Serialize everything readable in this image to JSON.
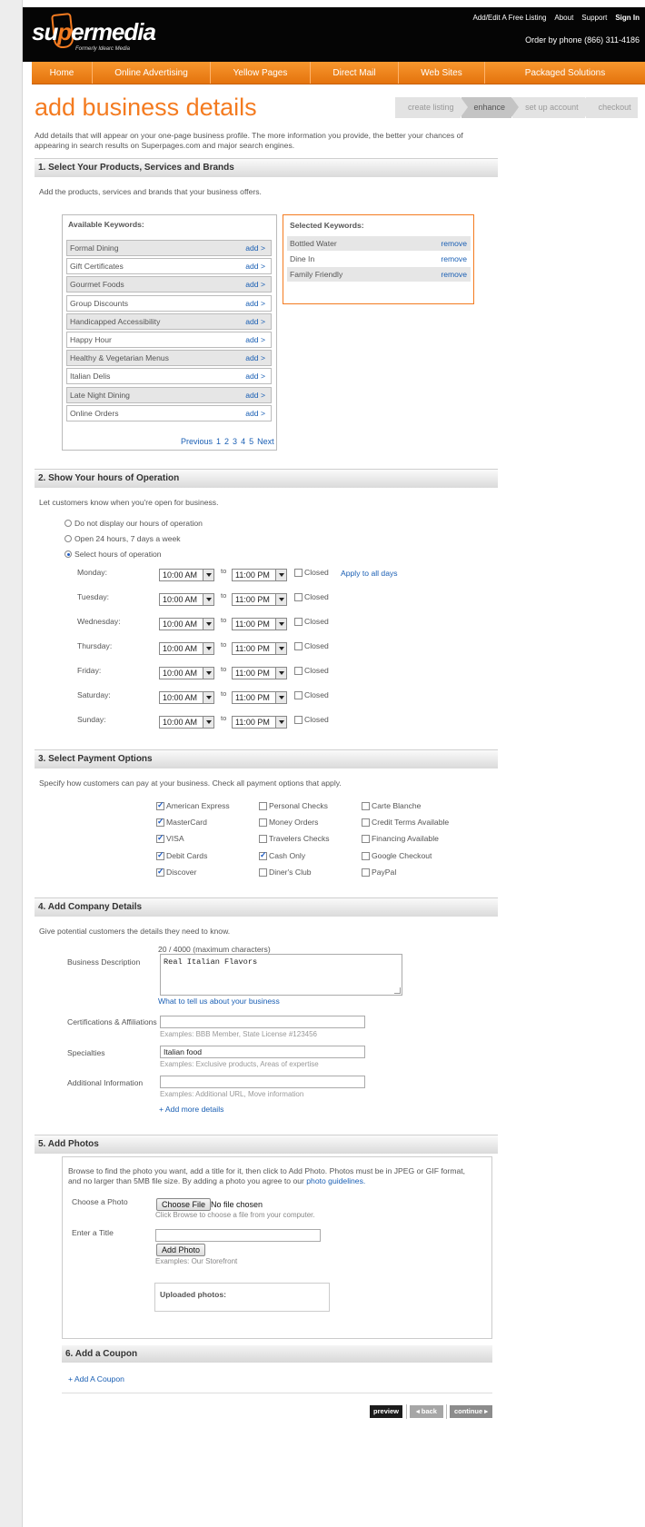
{
  "header": {
    "logo": {
      "brand": "supermedia",
      "subtitle": "Formerly Idearc Media"
    },
    "top_links": [
      "Add/Edit A Free Listing",
      "About",
      "Support",
      "Sign In"
    ],
    "phone": "Order by phone (866) 311-4186"
  },
  "nav": [
    "Home",
    "Online Advertising",
    "Yellow Pages",
    "Direct Mail",
    "Web Sites",
    "Packaged Solutions"
  ],
  "page_title": "add business details",
  "steps": [
    "create listing",
    "enhance",
    "set up account",
    "checkout"
  ],
  "active_step": "enhance",
  "intro": "Add details that will appear on your one-page business profile. The more information you provide, the better your chances of appearing in search results on Superpages.com and major search engines.",
  "section1": {
    "heading": "1. Select Your Products, Services and Brands",
    "desc": "Add the products, services and brands that your business offers.",
    "available_title": "Available Keywords:",
    "available": [
      "Formal Dining",
      "Gift Certificates",
      "Gourmet Foods",
      "Group Discounts",
      "Handicapped Accessibility",
      "Happy Hour",
      "Healthy & Vegetarian Menus",
      "Italian Delis",
      "Late Night Dining",
      "Online Orders"
    ],
    "add_label": "add >",
    "selected_title": "Selected Keywords:",
    "selected": [
      "Bottled Water",
      "Dine In",
      "Family Friendly"
    ],
    "remove_label": "remove",
    "pager": [
      "Previous",
      "1",
      "2",
      "3",
      "4",
      "5",
      "Next"
    ]
  },
  "section2": {
    "heading": "2. Show Your hours of Operation",
    "desc": "Let customers know when you're open for business.",
    "options": [
      "Do not display our hours of operation",
      "Open 24 hours, 7 days a week",
      "Select hours of operation"
    ],
    "selected_option": 2,
    "to_label": "to",
    "closed_label": "Closed",
    "apply_all": "Apply to all days",
    "days": [
      {
        "day": "Monday:",
        "open": "10:00 AM",
        "close": "11:00 PM"
      },
      {
        "day": "Tuesday:",
        "open": "10:00 AM",
        "close": "11:00 PM"
      },
      {
        "day": "Wednesday:",
        "open": "10:00 AM",
        "close": "11:00 PM"
      },
      {
        "day": "Thursday:",
        "open": "10:00 AM",
        "close": "11:00 PM"
      },
      {
        "day": "Friday:",
        "open": "10:00 AM",
        "close": "11:00 PM"
      },
      {
        "day": "Saturday:",
        "open": "10:00 AM",
        "close": "11:00 PM"
      },
      {
        "day": "Sunday:",
        "open": "10:00 AM",
        "close": "11:00 PM"
      }
    ]
  },
  "section3": {
    "heading": "3. Select Payment Options",
    "desc": "Specify how customers can pay at your business. Check all payment options that apply.",
    "options": [
      {
        "label": "American Express",
        "checked": true
      },
      {
        "label": "MasterCard",
        "checked": true
      },
      {
        "label": "VISA",
        "checked": true
      },
      {
        "label": "Debit Cards",
        "checked": true
      },
      {
        "label": "Discover",
        "checked": true
      },
      {
        "label": "Personal Checks",
        "checked": false
      },
      {
        "label": "Money Orders",
        "checked": false
      },
      {
        "label": "Travelers Checks",
        "checked": false
      },
      {
        "label": "Cash Only",
        "checked": true
      },
      {
        "label": "Diner's Club",
        "checked": false
      },
      {
        "label": "Carte Blanche",
        "checked": false
      },
      {
        "label": "Credit Terms Available",
        "checked": false
      },
      {
        "label": "Financing Available",
        "checked": false
      },
      {
        "label": "Google Checkout",
        "checked": false
      },
      {
        "label": "PayPal",
        "checked": false
      }
    ]
  },
  "section4": {
    "heading": "4. Add Company Details",
    "desc": "Give potential customers the details they need to know.",
    "char_count": "20 / 4000 (maximum characters)",
    "desc_label": "Business Description",
    "desc_value": "Real Italian Flavors",
    "desc_help": "What to tell us about your business",
    "cert_label": "Certifications & Affiliations",
    "cert_value": "",
    "cert_hint": "Examples: BBB Member, State License #123456",
    "spec_label": "Specialties",
    "spec_value": "Italian food",
    "spec_hint": "Examples: Exclusive products, Areas of expertise",
    "addl_label": "Additional Information",
    "addl_value": "",
    "addl_hint": "Examples: Additional URL, Move information",
    "add_more": "+ Add more details"
  },
  "section5": {
    "heading": "5. Add Photos",
    "desc_pre": "Browse to find the photo you want, add a title for it, then click to Add Photo. Photos must be in JPEG or GIF format, and no larger than 5MB file size. By adding a photo you agree to our",
    "desc_link": "photo guidelines.",
    "choose_label": "Choose a Photo",
    "choose_btn": "Choose File",
    "no_file": "No file chosen",
    "choose_hint": "Click Browse to choose a file from your computer.",
    "title_label": "Enter a Title",
    "title_value": "",
    "add_btn": "Add Photo",
    "title_hint": "Examples: Our Storefront",
    "uploaded_label": "Uploaded photos:"
  },
  "section6": {
    "heading": "6. Add a Coupon",
    "add_link": "+ Add A Coupon"
  },
  "buttons": {
    "preview": "preview",
    "back": "◂ back",
    "continue": "continue ▸"
  }
}
